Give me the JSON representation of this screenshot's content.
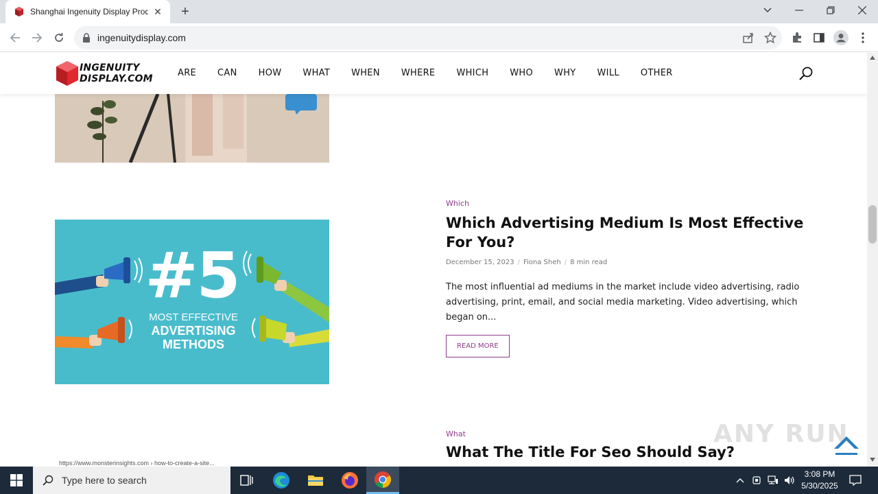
{
  "browser": {
    "tab_title": "Shanghai Ingenuity Display Prod",
    "url": "ingenuitydisplay.com",
    "new_tab_symbol": "+",
    "close_symbol": "✕"
  },
  "site": {
    "logo_line1": "INGENUITY",
    "logo_line2": "DISPLAY.COM",
    "menu": [
      "ARE",
      "CAN",
      "HOW",
      "WHAT",
      "WHEN",
      "WHERE",
      "WHICH",
      "WHO",
      "WHY",
      "WILL",
      "OTHER"
    ]
  },
  "posts": [
    {
      "category": "Which",
      "title": "Which Advertising Medium Is Most Effective For You?",
      "date": "December 15, 2023",
      "author": "Fiona Sheh",
      "read_time": "8 min read",
      "excerpt": "The most influential ad mediums in the market include video advertising, radio advertising, print, email, and social media marketing. Video advertising, which began on...",
      "read_more": "READ MORE",
      "image_text": {
        "big": "#5",
        "line1": "MOST EFFECTIVE",
        "line2": "ADVERTISING",
        "line3": "METHODS"
      }
    },
    {
      "category": "What",
      "title": "What The Title For Seo Should Say?"
    }
  ],
  "bottom_thumb_url": "https://www.monsterinsights.com › how-to-create-a-site...",
  "watermark": "ANY RUN",
  "taskbar": {
    "search_placeholder": "Type here to search",
    "time": "3:08 PM",
    "date": "5/30/2025"
  },
  "colors": {
    "accent": "#8e3b8a",
    "thumb_bg": "#4dbfd0",
    "logo_red": "#e0282e",
    "taskbar": "#1c2a3a"
  }
}
